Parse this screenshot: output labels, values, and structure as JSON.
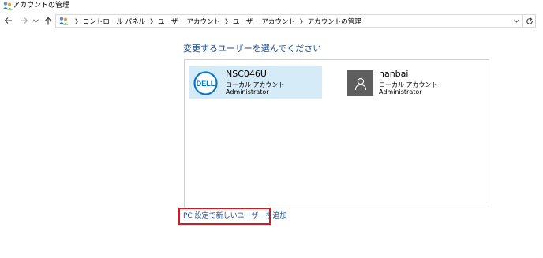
{
  "window": {
    "title": "アカウントの管理",
    "icon": "users-icon"
  },
  "nav": {
    "back_icon": "back-arrow-icon",
    "forward_icon": "forward-arrow-icon",
    "recent_icon": "chevron-down-icon",
    "up_icon": "up-arrow-icon",
    "refresh_icon": "refresh-icon"
  },
  "breadcrumbs": [
    "コントロール パネル",
    "ユーザー アカウント",
    "ユーザー アカウント",
    "アカウントの管理"
  ],
  "main": {
    "heading": "変更するユーザーを選んでください",
    "add_user_link": "PC 設定で新しいユーザーを追加"
  },
  "accounts": [
    {
      "name": "NSC046U",
      "type": "ローカル アカウント",
      "role": "Administrator",
      "picture": "dell-logo",
      "logo_text": "DELL",
      "selected": true
    },
    {
      "name": "hanbai",
      "type": "ローカル アカウント",
      "role": "Administrator",
      "picture": "default-user-icon",
      "selected": false
    }
  ],
  "colors": {
    "link": "#1e4e8c",
    "selection": "#d6ebf8",
    "highlight_box": "#e0161b",
    "dell_blue": "#0a75c2",
    "avatar_gray": "#5e5e5e"
  }
}
